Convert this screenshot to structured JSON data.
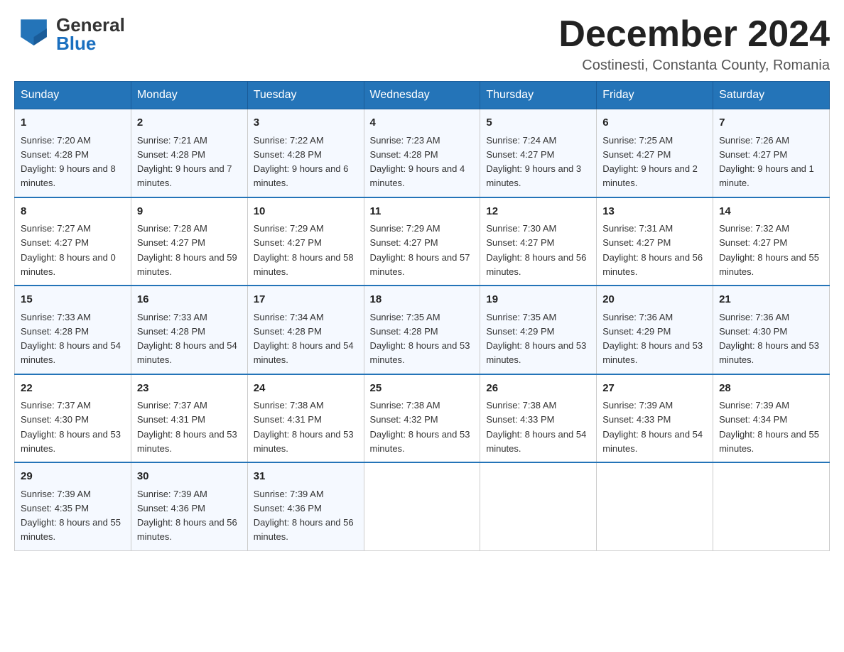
{
  "header": {
    "logo_line1": "General",
    "logo_line2": "Blue",
    "month_title": "December 2024",
    "location": "Costinesti, Constanta County, Romania"
  },
  "weekdays": [
    "Sunday",
    "Monday",
    "Tuesday",
    "Wednesday",
    "Thursday",
    "Friday",
    "Saturday"
  ],
  "weeks": [
    [
      {
        "day": "1",
        "sunrise": "7:20 AM",
        "sunset": "4:28 PM",
        "daylight": "9 hours and 8 minutes."
      },
      {
        "day": "2",
        "sunrise": "7:21 AM",
        "sunset": "4:28 PM",
        "daylight": "9 hours and 7 minutes."
      },
      {
        "day": "3",
        "sunrise": "7:22 AM",
        "sunset": "4:28 PM",
        "daylight": "9 hours and 6 minutes."
      },
      {
        "day": "4",
        "sunrise": "7:23 AM",
        "sunset": "4:28 PM",
        "daylight": "9 hours and 4 minutes."
      },
      {
        "day": "5",
        "sunrise": "7:24 AM",
        "sunset": "4:27 PM",
        "daylight": "9 hours and 3 minutes."
      },
      {
        "day": "6",
        "sunrise": "7:25 AM",
        "sunset": "4:27 PM",
        "daylight": "9 hours and 2 minutes."
      },
      {
        "day": "7",
        "sunrise": "7:26 AM",
        "sunset": "4:27 PM",
        "daylight": "9 hours and 1 minute."
      }
    ],
    [
      {
        "day": "8",
        "sunrise": "7:27 AM",
        "sunset": "4:27 PM",
        "daylight": "8 hours and 0 minutes."
      },
      {
        "day": "9",
        "sunrise": "7:28 AM",
        "sunset": "4:27 PM",
        "daylight": "8 hours and 59 minutes."
      },
      {
        "day": "10",
        "sunrise": "7:29 AM",
        "sunset": "4:27 PM",
        "daylight": "8 hours and 58 minutes."
      },
      {
        "day": "11",
        "sunrise": "7:29 AM",
        "sunset": "4:27 PM",
        "daylight": "8 hours and 57 minutes."
      },
      {
        "day": "12",
        "sunrise": "7:30 AM",
        "sunset": "4:27 PM",
        "daylight": "8 hours and 56 minutes."
      },
      {
        "day": "13",
        "sunrise": "7:31 AM",
        "sunset": "4:27 PM",
        "daylight": "8 hours and 56 minutes."
      },
      {
        "day": "14",
        "sunrise": "7:32 AM",
        "sunset": "4:27 PM",
        "daylight": "8 hours and 55 minutes."
      }
    ],
    [
      {
        "day": "15",
        "sunrise": "7:33 AM",
        "sunset": "4:28 PM",
        "daylight": "8 hours and 54 minutes."
      },
      {
        "day": "16",
        "sunrise": "7:33 AM",
        "sunset": "4:28 PM",
        "daylight": "8 hours and 54 minutes."
      },
      {
        "day": "17",
        "sunrise": "7:34 AM",
        "sunset": "4:28 PM",
        "daylight": "8 hours and 54 minutes."
      },
      {
        "day": "18",
        "sunrise": "7:35 AM",
        "sunset": "4:28 PM",
        "daylight": "8 hours and 53 minutes."
      },
      {
        "day": "19",
        "sunrise": "7:35 AM",
        "sunset": "4:29 PM",
        "daylight": "8 hours and 53 minutes."
      },
      {
        "day": "20",
        "sunrise": "7:36 AM",
        "sunset": "4:29 PM",
        "daylight": "8 hours and 53 minutes."
      },
      {
        "day": "21",
        "sunrise": "7:36 AM",
        "sunset": "4:30 PM",
        "daylight": "8 hours and 53 minutes."
      }
    ],
    [
      {
        "day": "22",
        "sunrise": "7:37 AM",
        "sunset": "4:30 PM",
        "daylight": "8 hours and 53 minutes."
      },
      {
        "day": "23",
        "sunrise": "7:37 AM",
        "sunset": "4:31 PM",
        "daylight": "8 hours and 53 minutes."
      },
      {
        "day": "24",
        "sunrise": "7:38 AM",
        "sunset": "4:31 PM",
        "daylight": "8 hours and 53 minutes."
      },
      {
        "day": "25",
        "sunrise": "7:38 AM",
        "sunset": "4:32 PM",
        "daylight": "8 hours and 53 minutes."
      },
      {
        "day": "26",
        "sunrise": "7:38 AM",
        "sunset": "4:33 PM",
        "daylight": "8 hours and 54 minutes."
      },
      {
        "day": "27",
        "sunrise": "7:39 AM",
        "sunset": "4:33 PM",
        "daylight": "8 hours and 54 minutes."
      },
      {
        "day": "28",
        "sunrise": "7:39 AM",
        "sunset": "4:34 PM",
        "daylight": "8 hours and 55 minutes."
      }
    ],
    [
      {
        "day": "29",
        "sunrise": "7:39 AM",
        "sunset": "4:35 PM",
        "daylight": "8 hours and 55 minutes."
      },
      {
        "day": "30",
        "sunrise": "7:39 AM",
        "sunset": "4:36 PM",
        "daylight": "8 hours and 56 minutes."
      },
      {
        "day": "31",
        "sunrise": "7:39 AM",
        "sunset": "4:36 PM",
        "daylight": "8 hours and 56 minutes."
      },
      null,
      null,
      null,
      null
    ]
  ],
  "labels": {
    "sunrise": "Sunrise:",
    "sunset": "Sunset:",
    "daylight": "Daylight:"
  }
}
